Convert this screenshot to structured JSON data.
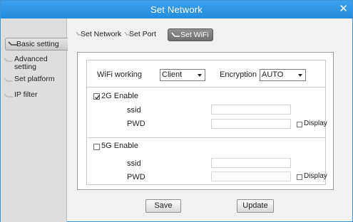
{
  "window": {
    "title": "Set Network",
    "close_glyph": "✕"
  },
  "sidebar": {
    "items": [
      {
        "label": "Basic setting",
        "active": true
      },
      {
        "label": "Advanced setting",
        "active": false
      },
      {
        "label": "Set platform",
        "active": false
      },
      {
        "label": "IP filter",
        "active": false
      }
    ]
  },
  "tabs": [
    {
      "label": "Set Network",
      "active": false
    },
    {
      "label": "Set Port",
      "active": false
    },
    {
      "label": "Set WiFi",
      "active": true
    }
  ],
  "wifi": {
    "working_label": "WiFi working",
    "working_value": "Client",
    "encryption_label": "Encryption",
    "encryption_value": "AUTO"
  },
  "band_2g": {
    "enable_label": "2G Enable",
    "enabled": true,
    "ssid_label": "ssid",
    "ssid_value": "",
    "pwd_label": "PWD",
    "pwd_value": "",
    "display_label": "Display",
    "display_checked": false
  },
  "band_5g": {
    "enable_label": "5G Enable",
    "enabled": false,
    "ssid_label": "ssid",
    "ssid_value": "",
    "pwd_label": "PWD",
    "pwd_value": "",
    "display_label": "Display",
    "display_checked": false
  },
  "actions": {
    "save_label": "Save",
    "update_label": "Update"
  },
  "colors": {
    "titlebar": "#2b93e4",
    "tab_active": "#7f7f7f",
    "sidebar": "#dedede"
  }
}
